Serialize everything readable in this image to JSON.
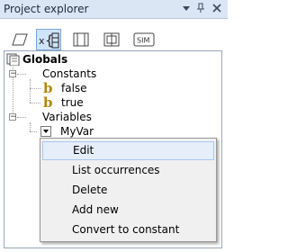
{
  "panel": {
    "title": "Project explorer"
  },
  "toolbar": {
    "tools": [
      {
        "icon": "parallelogram-icon",
        "active": false
      },
      {
        "icon": "variables-icon",
        "active": true
      },
      {
        "icon": "frame-icon",
        "active": false
      },
      {
        "icon": "block-icon",
        "active": false
      },
      {
        "icon": "sim-icon",
        "label": "SIM",
        "active": false
      }
    ]
  },
  "tree": {
    "root": "Globals",
    "constants": {
      "label": "Constants",
      "items": [
        "false",
        "true"
      ]
    },
    "variables": {
      "label": "Variables",
      "items": [
        "MyVar"
      ]
    }
  },
  "context_menu": {
    "items": [
      "Edit",
      "List occurrences",
      "Delete",
      "Add new",
      "Convert to constant"
    ],
    "highlighted": "Edit"
  },
  "colors": {
    "titlebar": "#dbe6f4",
    "selection": "#cfe3fb",
    "icon_gold": "#b38600"
  }
}
